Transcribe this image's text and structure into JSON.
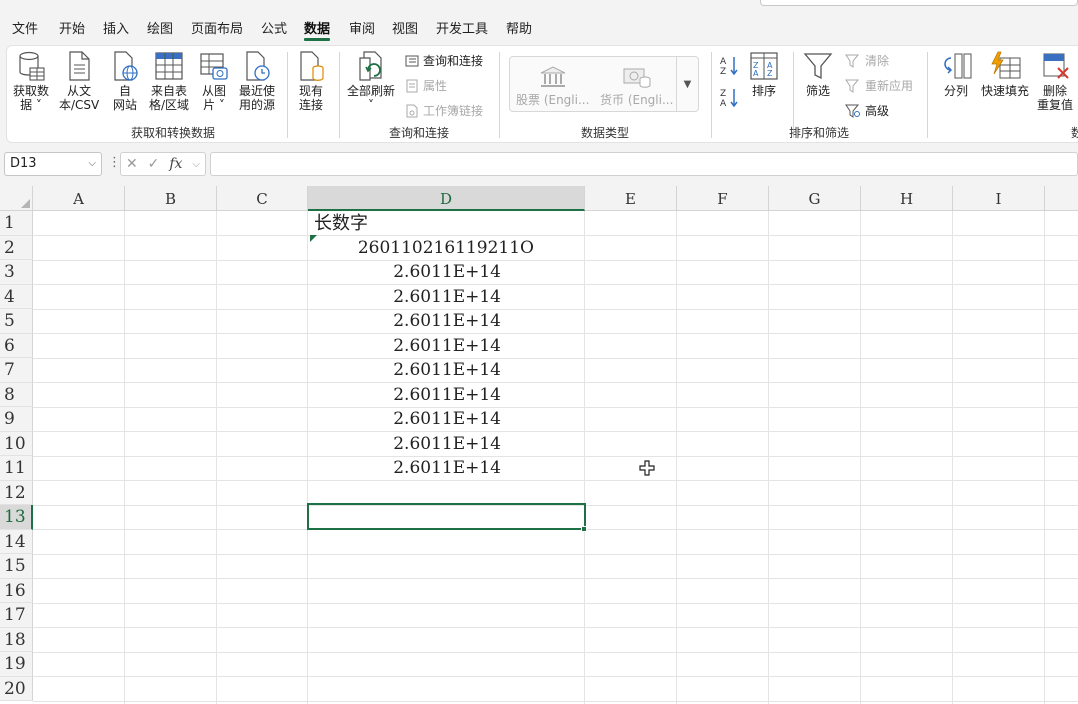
{
  "menu": {
    "tabs": [
      "文件",
      "开始",
      "插入",
      "绘图",
      "页面布局",
      "公式",
      "数据",
      "审阅",
      "视图",
      "开发工具",
      "帮助"
    ],
    "active": "数据"
  },
  "ribbon": {
    "get_data": {
      "buttons": [
        {
          "line1": "获取数",
          "line2": "据 ˅"
        },
        {
          "line1": "从文",
          "line2": "本/CSV"
        },
        {
          "line1": "自",
          "line2": "网站"
        },
        {
          "line1": "来自表",
          "line2": "格/区域"
        },
        {
          "line1": "从图",
          "line2": "片 ˅"
        },
        {
          "line1": "最近使",
          "line2": "用的源"
        },
        {
          "line1": "现有",
          "line2": "连接"
        }
      ],
      "label": "获取和转换数据"
    },
    "queries": {
      "refresh_all": "全部刷新",
      "refresh_caret": "˅",
      "queries_connections": "查询和连接",
      "properties": "属性",
      "workbook_links": "工作簿链接",
      "label": "查询和连接"
    },
    "data_types": {
      "stocks": "股票 (Engli...",
      "currencies": "货币 (Engli...",
      "label": "数据类型"
    },
    "sort_filter": {
      "sort": "排序",
      "filter": "筛选",
      "clear": "清除",
      "reapply": "重新应用",
      "advanced": "高级",
      "label": "排序和筛选"
    },
    "tools": {
      "text_to_columns": "分列",
      "flash_fill": "快速填充",
      "remove_dup_line1": "删除",
      "remove_dup_line2": "重复值",
      "label_partial": "数"
    }
  },
  "formula_bar": {
    "name_box": "D13",
    "fx": "fx",
    "formula": ""
  },
  "sheet": {
    "columns": [
      "A",
      "B",
      "C",
      "D",
      "E",
      "F",
      "G",
      "H",
      "I"
    ],
    "selected_column": "D",
    "rows": [
      "1",
      "2",
      "3",
      "4",
      "5",
      "6",
      "7",
      "8",
      "9",
      "10",
      "11",
      "12",
      "13",
      "14",
      "15",
      "16",
      "17",
      "18",
      "19",
      "20"
    ],
    "selected_row": "13",
    "active_cell": "D13",
    "cells": {
      "D1": "长数字",
      "D2": "260110216119211O",
      "D3": "2.6011E+14",
      "D4": "2.6011E+14",
      "D5": "2.6011E+14",
      "D6": "2.6011E+14",
      "D7": "2.6011E+14",
      "D8": "2.6011E+14",
      "D9": "2.6011E+14",
      "D10": "2.6011E+14",
      "D11": "2.6011E+14"
    }
  },
  "colors": {
    "accent": "#1e7145",
    "header_bg": "#f3f3f3",
    "selected_header_bg": "#d9d9d9"
  }
}
